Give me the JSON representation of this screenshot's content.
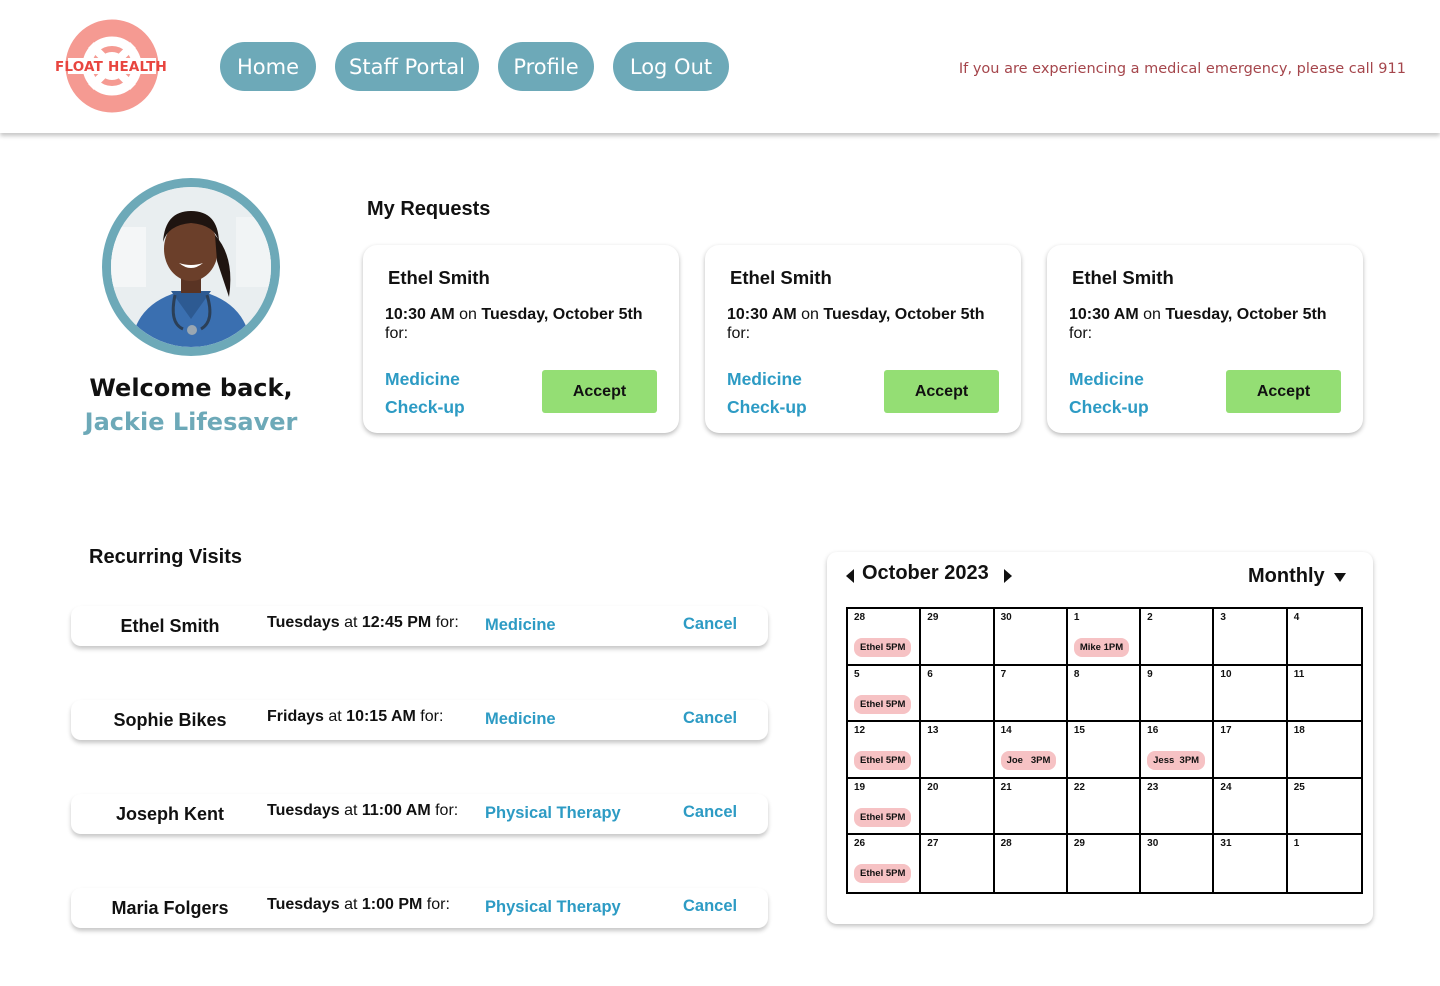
{
  "brand": {
    "logo_text": "FLOAT HEALTH",
    "color": "#f28b82",
    "text_color": "#e8453f"
  },
  "nav": {
    "home": "Home",
    "staff_portal": "Staff Portal",
    "profile": "Profile",
    "logout": "Log Out",
    "accent": "#6da9b8"
  },
  "emergency_notice": "If you are experiencing a medical emergency, please call 911",
  "profile": {
    "welcome": "Welcome back,",
    "name": "Jackie Lifesaver"
  },
  "requests": {
    "title": "My Requests",
    "items": [
      {
        "patient": "Ethel Smith",
        "time": "10:30 AM",
        "on": "on",
        "date": "Tuesday, October 5th",
        "for": "for:",
        "type_line1": "Medicine",
        "type_line2": "Check-up",
        "action": "Accept"
      },
      {
        "patient": "Ethel Smith",
        "time": "10:30 AM",
        "on": "on",
        "date": "Tuesday, October 5th",
        "for": "for:",
        "type_line1": "Medicine",
        "type_line2": "Check-up",
        "action": "Accept"
      },
      {
        "patient": "Ethel Smith",
        "time": "10:30 AM",
        "on": "on",
        "date": "Tuesday, October 5th",
        "for": "for:",
        "type_line1": "Medicine",
        "type_line2": "Check-up",
        "action": "Accept"
      }
    ]
  },
  "recurring": {
    "title": "Recurring Visits",
    "items": [
      {
        "patient": "Ethel Smith",
        "day": "Tuesdays",
        "at": "at",
        "time": "12:45 PM",
        "for": "for:",
        "type": "Medicine",
        "action": "Cancel"
      },
      {
        "patient": "Sophie Bikes",
        "day": "Fridays",
        "at": "at",
        "time": "10:15 AM",
        "for": "for:",
        "type": "Medicine",
        "action": "Cancel"
      },
      {
        "patient": "Joseph Kent",
        "day": "Tuesdays",
        "at": "at",
        "time": "11:00 AM",
        "for": "for:",
        "type": "Physical Therapy",
        "action": "Cancel"
      },
      {
        "patient": "Maria Folgers",
        "day": "Tuesdays",
        "at": "at",
        "time": "1:00 PM",
        "for": "for:",
        "type": "Physical Therapy",
        "action": "Cancel"
      }
    ]
  },
  "calendar": {
    "month_label": "October 2023",
    "view_label": "Monthly",
    "event_color": "#f6c2c4",
    "cells": [
      {
        "day": "28",
        "event": "Ethel 5PM"
      },
      {
        "day": "29"
      },
      {
        "day": "30"
      },
      {
        "day": "1",
        "event": "Mike 1PM"
      },
      {
        "day": "2"
      },
      {
        "day": "3"
      },
      {
        "day": "4"
      },
      {
        "day": "5",
        "event": "Ethel 5PM"
      },
      {
        "day": "6"
      },
      {
        "day": "7"
      },
      {
        "day": "8"
      },
      {
        "day": "9"
      },
      {
        "day": "10"
      },
      {
        "day": "11"
      },
      {
        "day": "12",
        "event": "Ethel 5PM"
      },
      {
        "day": "13"
      },
      {
        "day": "14",
        "event": "Joe   3PM"
      },
      {
        "day": "15"
      },
      {
        "day": "16",
        "event": "Jess  3PM"
      },
      {
        "day": "17"
      },
      {
        "day": "18"
      },
      {
        "day": "19",
        "event": "Ethel 5PM"
      },
      {
        "day": "20"
      },
      {
        "day": "21"
      },
      {
        "day": "22"
      },
      {
        "day": "23"
      },
      {
        "day": "24"
      },
      {
        "day": "25"
      },
      {
        "day": "26",
        "event": "Ethel 5PM"
      },
      {
        "day": "27"
      },
      {
        "day": "28"
      },
      {
        "day": "29"
      },
      {
        "day": "30"
      },
      {
        "day": "31"
      },
      {
        "day": "1"
      }
    ]
  }
}
